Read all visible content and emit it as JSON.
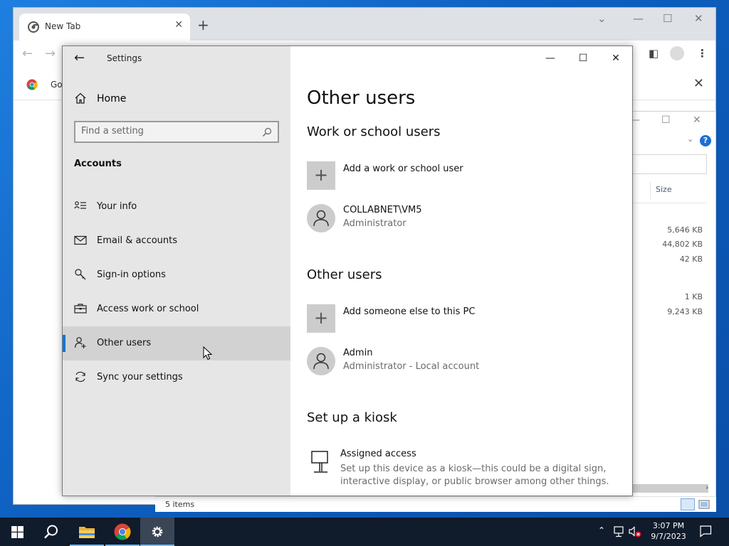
{
  "chrome": {
    "tab_title": "New Tab",
    "bookmark_label": "Go"
  },
  "explorer": {
    "column_size": "Size",
    "sizes": [
      "5,646 KB",
      "44,802 KB",
      "42 KB",
      "1 KB",
      "9,243 KB"
    ],
    "status": "5 items"
  },
  "settings": {
    "window_title": "Settings",
    "home_label": "Home",
    "search_placeholder": "Find a setting",
    "section_label": "Accounts",
    "nav_items": [
      {
        "label": "Your info",
        "icon": "person-card-icon"
      },
      {
        "label": "Email & accounts",
        "icon": "mail-icon"
      },
      {
        "label": "Sign-in options",
        "icon": "key-icon"
      },
      {
        "label": "Access work or school",
        "icon": "briefcase-icon"
      },
      {
        "label": "Other users",
        "icon": "person-add-icon",
        "selected": true
      },
      {
        "label": "Sync your settings",
        "icon": "sync-icon"
      }
    ],
    "page_title": "Other users",
    "work_section": {
      "heading": "Work or school users",
      "add_label": "Add a work or school user",
      "users": [
        {
          "name": "COLLABNET\\VM5",
          "role": "Administrator"
        }
      ]
    },
    "other_section": {
      "heading": "Other users",
      "add_label": "Add someone else to this PC",
      "users": [
        {
          "name": "Admin",
          "role": "Administrator - Local account"
        }
      ]
    },
    "kiosk_section": {
      "heading": "Set up a kiosk",
      "item_title": "Assigned access",
      "item_desc": "Set up this device as a kiosk—this could be a digital sign, interactive display, or public browser among other things."
    }
  },
  "taskbar": {
    "time": "3:07 PM",
    "date": "9/7/2023"
  },
  "colors": {
    "accent": "#0078d4",
    "sidebar_bg": "#e6e6e6",
    "selected_bg": "#d2d2d2",
    "taskbar_bg": "#101b2b"
  }
}
